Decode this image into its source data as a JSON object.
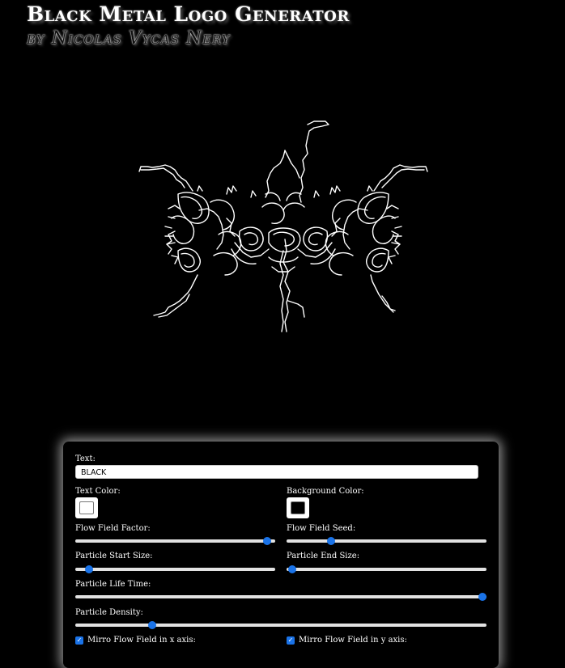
{
  "header": {
    "title": "Black Metal Logo Generator",
    "subtitle": "by Nicolas Vycas Nery"
  },
  "logo": {
    "text": "BLACK",
    "stroke_color": "#ffffff",
    "background": "#000000"
  },
  "controls": {
    "text_label": "Text:",
    "text_value": "BLACK",
    "text_color_label": "Text Color:",
    "text_color": "#ffffff",
    "background_color_label": "Background Color:",
    "background_color": "#000000",
    "flow_field_factor_label": "Flow Field Factor:",
    "flow_field_factor_fraction": 0.98,
    "flow_field_seed_label": "Flow Field Seed:",
    "flow_field_seed_fraction": 0.21,
    "particle_start_size_label": "Particle Start Size:",
    "particle_start_size_fraction": 0.05,
    "particle_end_size_label": "Particle End Size:",
    "particle_end_size_fraction": 0.01,
    "particle_life_time_label": "Particle Life Time:",
    "particle_life_time_fraction": 1.0,
    "particle_density_label": "Particle Density:",
    "particle_density_fraction": 0.18,
    "mirror_x_label": "Mirro Flow Field in x axis:",
    "mirror_x_checked": true,
    "mirror_y_label": "Mirro Flow Field in y axis:",
    "mirror_y_checked": true
  },
  "icons": {
    "checkbox": "check-icon"
  },
  "colors": {
    "accent": "#1a73e8",
    "page_bg": "#000000",
    "track": "#e2e2e2"
  }
}
